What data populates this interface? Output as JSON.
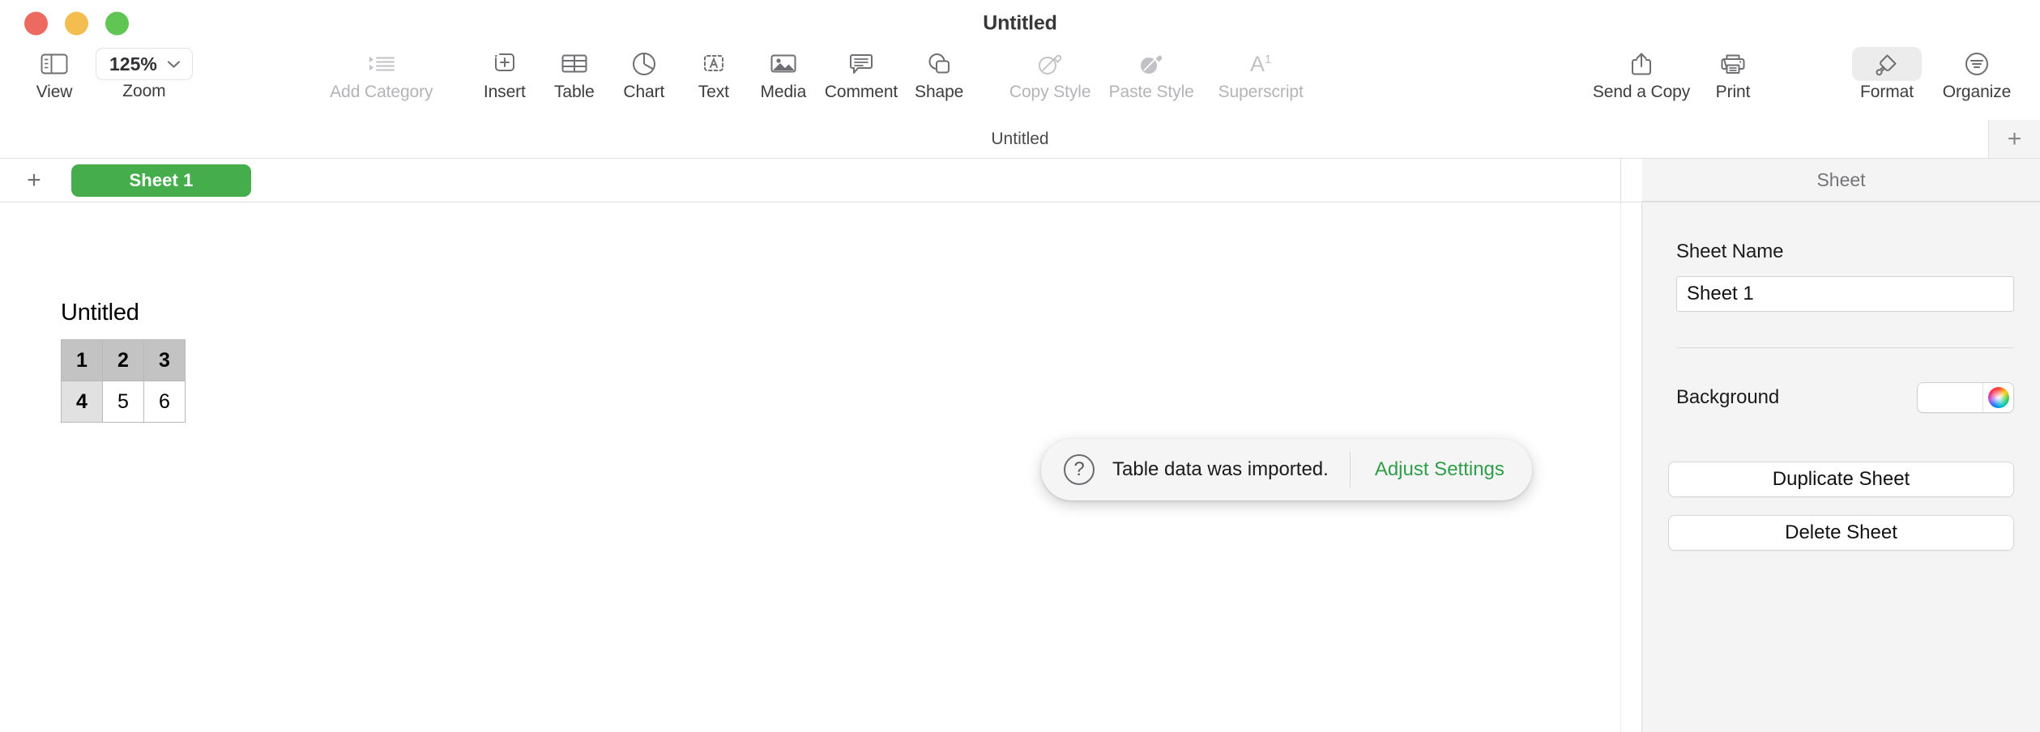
{
  "window": {
    "title": "Untitled",
    "traffic_lights": [
      {
        "name": "close",
        "color": "#ec6a5f"
      },
      {
        "name": "minimize",
        "color": "#f4bd4f"
      },
      {
        "name": "zoom",
        "color": "#61c554"
      }
    ]
  },
  "toolbar": {
    "view": {
      "label": "View",
      "icon": "sidebar-view-icon"
    },
    "zoom": {
      "label": "Zoom",
      "value": "125%",
      "icon": "chevron-down-icon"
    },
    "items": [
      {
        "label": "Add Category",
        "icon": "bulleted-list-icon",
        "disabled": true
      },
      {
        "label": "Insert",
        "icon": "insert-plus-box-icon",
        "disabled": false
      },
      {
        "label": "Table",
        "icon": "table-grid-icon",
        "disabled": false
      },
      {
        "label": "Chart",
        "icon": "pie-chart-icon",
        "disabled": false
      },
      {
        "label": "Text",
        "icon": "text-box-a-icon",
        "disabled": false
      },
      {
        "label": "Media",
        "icon": "photo-image-icon",
        "disabled": false
      },
      {
        "label": "Comment",
        "icon": "comment-bubble-icon",
        "disabled": false
      },
      {
        "label": "Shape",
        "icon": "shapes-icon",
        "disabled": false
      },
      {
        "label": "Copy Style",
        "icon": "eyedropper-outline-icon",
        "disabled": true
      },
      {
        "label": "Paste Style",
        "icon": "eyedropper-filled-icon",
        "disabled": true
      },
      {
        "label": "Superscript",
        "icon": "superscript-a-icon",
        "disabled": true
      }
    ],
    "right_items": [
      {
        "label": "Send a Copy",
        "icon": "share-icon",
        "disabled": false,
        "active": false
      },
      {
        "label": "Print",
        "icon": "printer-icon",
        "disabled": false,
        "active": false
      },
      {
        "label": "Format",
        "icon": "paintbrush-icon",
        "disabled": false,
        "active": true
      },
      {
        "label": "Organize",
        "icon": "organize-circle-icon",
        "disabled": false,
        "active": false
      }
    ]
  },
  "subbar": {
    "title": "Untitled",
    "add_label": "+"
  },
  "sheetbar": {
    "add_label": "+",
    "tabs": [
      {
        "label": "Sheet 1",
        "active": true
      }
    ]
  },
  "canvas": {
    "table": {
      "name": "Untitled",
      "header_row": [
        "1",
        "2",
        "3"
      ],
      "rows": [
        [
          "4",
          "5",
          "6"
        ]
      ]
    }
  },
  "notification": {
    "icon": "question-mark-circle-icon",
    "message": "Table data was imported.",
    "action_label": "Adjust Settings",
    "action_color": "#2f9e4a"
  },
  "sidebar": {
    "header": "Sheet",
    "sheet_name_label": "Sheet Name",
    "sheet_name_value": "Sheet 1",
    "background_label": "Background",
    "background_color": "#ffffff",
    "buttons": [
      {
        "label": "Duplicate Sheet"
      },
      {
        "label": "Delete Sheet"
      }
    ]
  }
}
